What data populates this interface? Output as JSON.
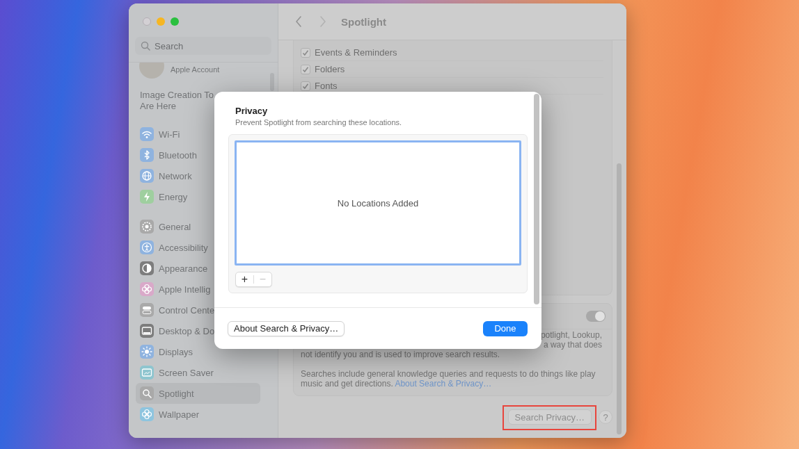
{
  "sidebar": {
    "search": {
      "placeholder": "Search"
    },
    "account": {
      "label": "Apple Account"
    },
    "notice_lines": [
      "Image Creation To",
      "Are Here"
    ],
    "groups": [
      {
        "items": [
          {
            "label": "Wi-Fi",
            "kind": "wifi",
            "color": "#8fb3df",
            "selected": false
          },
          {
            "label": "Bluetooth",
            "kind": "bluetooth",
            "color": "#8fb3df",
            "selected": false
          },
          {
            "label": "Network",
            "kind": "globe",
            "color": "#8fb3df",
            "selected": false
          },
          {
            "label": "Energy",
            "kind": "bolt",
            "color": "#9fcf9f",
            "selected": false
          }
        ]
      },
      {
        "items": [
          {
            "label": "General",
            "kind": "gear",
            "color": "#a9a9a9",
            "selected": false
          },
          {
            "label": "Accessibility",
            "kind": "person",
            "color": "#8fb3df",
            "selected": false
          },
          {
            "label": "Appearance",
            "kind": "contrast",
            "color": "#7d7d7d",
            "selected": false
          },
          {
            "label": "Apple Intellig",
            "kind": "flower",
            "color": "#d9a9c9",
            "selected": false
          },
          {
            "label": "Control Cente",
            "kind": "switches",
            "color": "#a9a9a9",
            "selected": false
          },
          {
            "label": "Desktop & Do",
            "kind": "dock",
            "color": "#7d7d7d",
            "selected": false
          },
          {
            "label": "Displays",
            "kind": "sun",
            "color": "#8fb3df",
            "selected": false
          },
          {
            "label": "Screen Saver",
            "kind": "screen",
            "color": "#8ec5cf",
            "selected": false
          },
          {
            "label": "Spotlight",
            "kind": "search",
            "color": "#a9a9a9",
            "selected": true
          },
          {
            "label": "Wallpaper",
            "kind": "flower",
            "color": "#8ec5df",
            "selected": false
          }
        ]
      }
    ]
  },
  "toolbar": {
    "title": "Spotlight",
    "back_button": {
      "disabled": false
    },
    "forward_button": {
      "disabled": true
    }
  },
  "results_card": {
    "rows": [
      {
        "label": "Events & Reminders",
        "checked": true
      },
      {
        "label": "Folders",
        "checked": true
      },
      {
        "label": "Fonts",
        "checked": true
      }
    ]
  },
  "suggestions_card": {
    "toggle": {
      "on": true
    },
    "description_lines": [
      "potlight, Lookup,",
      "a way that does",
      "not identify you and is used to improve search results."
    ],
    "note": "Searches include general knowledge queries and requests to do things like play music and get directions.",
    "note_link": "About Search & Privacy…"
  },
  "search_privacy_button": {
    "label": "Search Privacy…",
    "highlighted": true
  },
  "help_button": "?",
  "sheet": {
    "title": "Privacy",
    "subtitle": "Prevent Spotlight from searching these locations.",
    "empty_text": "No Locations Added",
    "add_button": {
      "label": "+",
      "disabled": false
    },
    "remove_button": {
      "label": "−",
      "disabled": true
    },
    "about_button": "About Search & Privacy…",
    "done_button": "Done"
  }
}
